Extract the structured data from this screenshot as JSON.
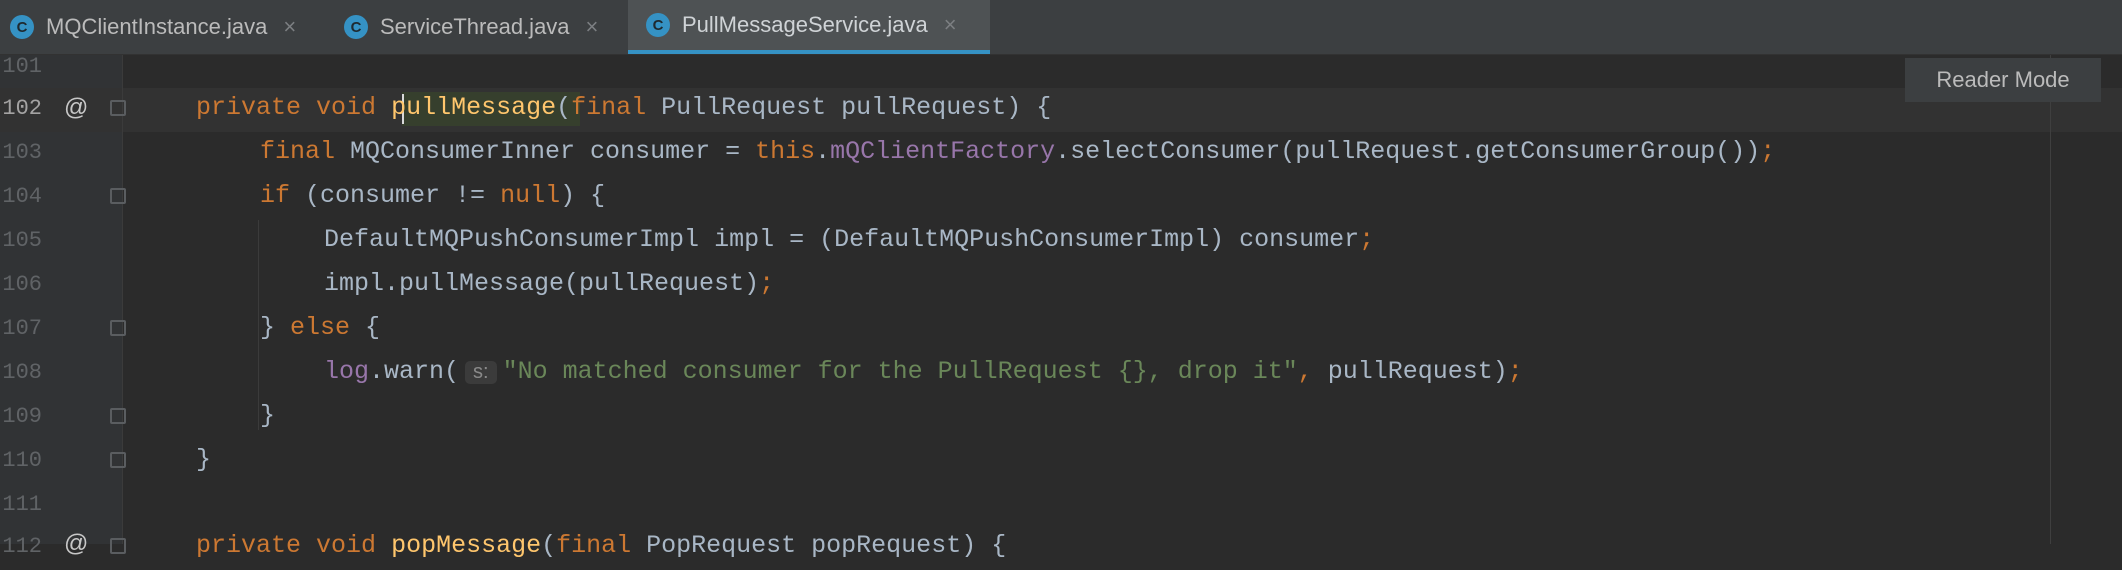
{
  "tabs": [
    {
      "label": "MQClientInstance.java",
      "icon": "class-c-icon"
    },
    {
      "label": "ServiceThread.java",
      "icon": "class-c-icon"
    },
    {
      "label": "PullMessageService.java",
      "icon": "class-c-icon",
      "active": true
    }
  ],
  "reader_mode_label": "Reader Mode",
  "lines": [
    {
      "num": "101"
    },
    {
      "num": "102"
    },
    {
      "num": "103"
    },
    {
      "num": "104"
    },
    {
      "num": "105"
    },
    {
      "num": "106"
    },
    {
      "num": "107"
    },
    {
      "num": "108"
    },
    {
      "num": "109"
    },
    {
      "num": "110"
    },
    {
      "num": "111"
    },
    {
      "num": "112"
    }
  ],
  "code": {
    "l102": {
      "kw1": "private",
      "kw2": "void",
      "fn": "pullMessage",
      "p1": "(",
      "kw3": "final",
      "rest": " PullRequest pullRequest) {"
    },
    "l103": {
      "kw1": "final",
      "t1": " MQConsumerInner consumer = ",
      "kw2": "this",
      "dot": ".",
      "fld": "mQClientFactory",
      "rest": ".selectConsumer(pullRequest.getConsumerGroup())",
      "semi": ";"
    },
    "l104": {
      "kw1": "if",
      "t1": " (consumer != ",
      "kw2": "null",
      "rest": ") {"
    },
    "l105": {
      "t1": "DefaultMQPushConsumerImpl impl = (DefaultMQPushConsumerImpl) consumer",
      "semi": ";"
    },
    "l106": {
      "t1": "impl.pullMessage(pullRequest)",
      "semi": ";"
    },
    "l107": {
      "t1": "} ",
      "kw1": "else",
      "rest": " {"
    },
    "l108": {
      "fld": "log",
      "t1": ".warn(",
      "hint": "s:",
      "str": "\"No matched consumer for the PullRequest {}, drop it\"",
      "comma": ",",
      "rest": " pullRequest)",
      "semi": ";"
    },
    "l109": {
      "t1": "}"
    },
    "l110": {
      "t1": "}"
    },
    "l112": {
      "kw1": "private",
      "kw2": "void",
      "fn": "popMessage",
      "p1": "(",
      "kw3": "final",
      "rest": " PopRequest popRequest) {"
    }
  }
}
